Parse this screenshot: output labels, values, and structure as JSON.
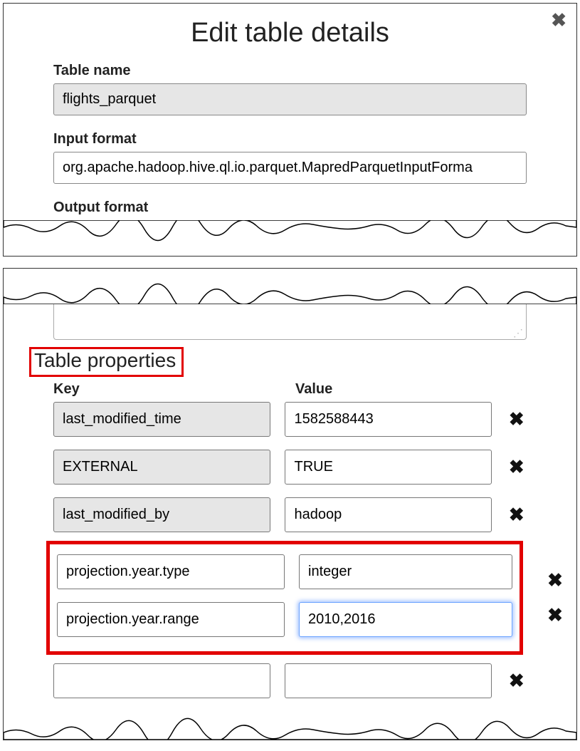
{
  "title": "Edit table details",
  "fields": {
    "table_name": {
      "label": "Table name",
      "value": "flights_parquet"
    },
    "input_format": {
      "label": "Input format",
      "value": "org.apache.hadoop.hive.ql.io.parquet.MapredParquetInputForma"
    },
    "output_format": {
      "label": "Output format"
    }
  },
  "properties": {
    "heading": "Table properties",
    "col_key": "Key",
    "col_val": "Value",
    "rows": [
      {
        "key": "last_modified_time",
        "value": "1582588443",
        "key_readonly": true
      },
      {
        "key": "EXTERNAL",
        "value": "TRUE",
        "key_readonly": true
      },
      {
        "key": "last_modified_by",
        "value": "hadoop",
        "key_readonly": true
      }
    ],
    "highlight_rows": [
      {
        "key": "projection.year.type",
        "value": "integer"
      },
      {
        "key": "projection.year.range",
        "value": "2010,2016",
        "focused": true
      }
    ],
    "empty_row": {
      "key": "",
      "value": ""
    }
  }
}
